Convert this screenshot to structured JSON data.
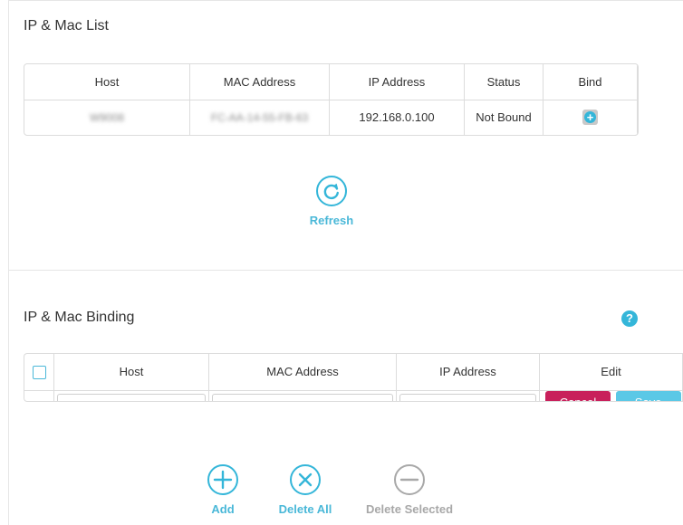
{
  "ip_mac_list": {
    "title": "IP & Mac List",
    "columns": [
      "Host",
      "MAC Address",
      "IP Address",
      "Status",
      "Bind"
    ],
    "rows": [
      {
        "host": "W9008",
        "mac": "FC-AA-14-55-FB-63",
        "ip": "192.168.0.100",
        "status": "Not Bound",
        "bind_icon": "plus-circle-icon"
      }
    ],
    "refresh_label": "Refresh"
  },
  "ip_mac_binding": {
    "title": "IP & Mac Binding",
    "help_icon": "question-circle-icon",
    "columns": [
      "Host",
      "MAC Address",
      "IP Address",
      "Edit"
    ],
    "edit_row": {
      "host_value": "",
      "mac_value": "",
      "ip_value": "",
      "cancel_label": "Cancel",
      "save_label": "Save"
    },
    "actions": {
      "add_label": "Add",
      "delete_all_label": "Delete All",
      "delete_selected_label": "Delete Selected"
    }
  },
  "colors": {
    "accent": "#34b6d9",
    "accent_text": "#4ab8d8",
    "disabled": "#a8a8a8",
    "cancel": "#c8205b",
    "save": "#5bc8e6",
    "border": "#dcdcdc"
  }
}
